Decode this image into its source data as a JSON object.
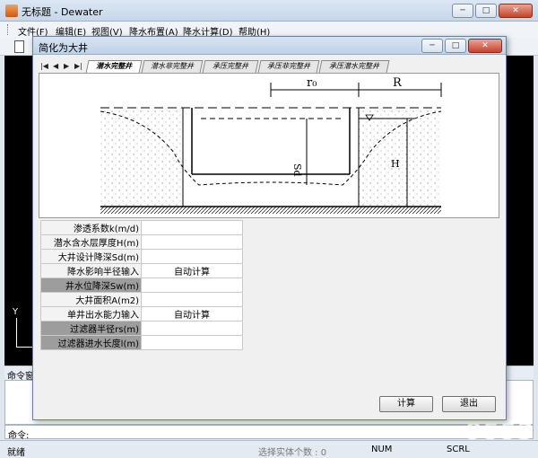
{
  "app": {
    "title": "无标题 - Dewater"
  },
  "menu": [
    "文件(F)",
    "编辑(E)",
    "视图(V)",
    "降水布置(A)",
    "降水计算(D)",
    "帮助(H)"
  ],
  "dialog": {
    "title": "简化为大井",
    "tabs": [
      "潜水完整井",
      "潜水非完整井",
      "承压完整井",
      "承压非完整井",
      "承压潜水完整井"
    ],
    "active_tab": 0,
    "diagram_labels": {
      "r0": "r₀",
      "R": "R",
      "sd": "Sd",
      "h": "H"
    },
    "params": [
      {
        "label": "渗透系数k(m/d)",
        "value": "",
        "disabled": false
      },
      {
        "label": "潜水含水层厚度H(m)",
        "value": "",
        "disabled": false
      },
      {
        "label": "大井设计降深Sd(m)",
        "value": "",
        "disabled": false
      },
      {
        "label": "降水影响半径输入",
        "value": "自动计算",
        "disabled": false
      },
      {
        "label": "井水位降深Sw(m)",
        "value": "",
        "disabled": true
      },
      {
        "label": "大井面积A(m2)",
        "value": "",
        "disabled": false
      },
      {
        "label": "单井出水能力输入",
        "value": "自动计算",
        "disabled": false
      },
      {
        "label": "过滤器半径rs(m)",
        "value": "",
        "disabled": true
      },
      {
        "label": "过滤器进水长度l(m)",
        "value": "",
        "disabled": true
      }
    ],
    "buttons": {
      "calc": "计算",
      "exit": "退出"
    }
  },
  "cmd": {
    "header": "命令窗",
    "prompt": "命令:"
  },
  "ucs_label": "Y",
  "status": {
    "ready": "就绪",
    "select": "选择实体个数 : 0",
    "num": "NUM",
    "scrl": "SCRL"
  },
  "watermark": "9553"
}
